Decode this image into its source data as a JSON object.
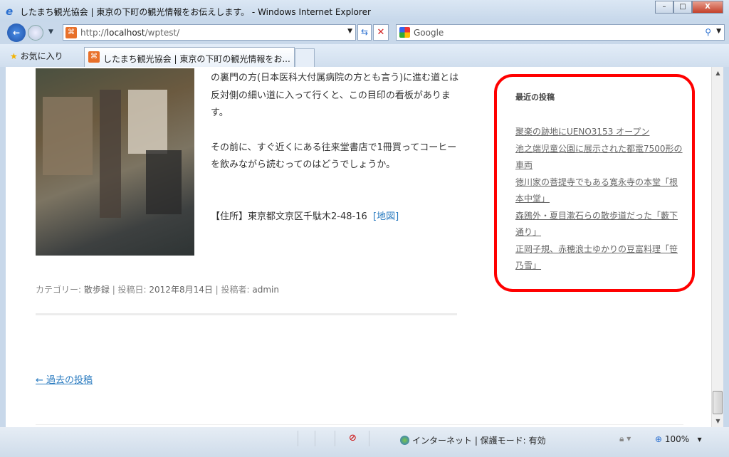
{
  "window": {
    "title": "したまち観光協会 | 東京の下町の観光情報をお伝えします。 - Windows Internet Explorer",
    "minimize": "–",
    "maximize": "□",
    "close": "X"
  },
  "toolbar": {
    "url_prefix": "http://",
    "url_host": "localhost",
    "url_path": "/wptest/",
    "search_placeholder": "Google"
  },
  "tabs": {
    "favorites_label": "お気に入り",
    "active_tab": "したまち観光協会 | 東京の下町の観光情報をお..."
  },
  "article": {
    "paragraph1": "の裏門の方(日本医科大付属病院の方とも言う)に進む道とは反対側の細い道に入って行くと、この目印の看板があります。",
    "paragraph2": "その前に、すぐ近くにある往来堂書店で1冊買ってコーヒーを飲みながら読むってのはどうでしょうか。",
    "address": "【住所】東京都文京区千駄木2-48-16",
    "map_link": "[地図]",
    "meta": {
      "category_label": "カテゴリー: ",
      "category": "散歩録",
      "date_label": " | 投稿日: ",
      "date": "2012年8月14日",
      "author_label": " | 投稿者: ",
      "author": "admin"
    },
    "prev_posts": "← 過去の投稿"
  },
  "sidebar": {
    "heading": "最近の投稿",
    "items": [
      {
        "label": "聚楽の跡地にUENO3153 オープン"
      },
      {
        "label": "池之端児童公園に展示された都電7500形の車両"
      },
      {
        "label": "徳川家の菩提寺でもある寛永寺の本堂「根本中堂」"
      },
      {
        "label": "森鴎外・夏目漱石らの散歩道だった「藪下通り」"
      },
      {
        "label": "正岡子規、赤穂浪士ゆかりの豆富料理「笹乃雪」"
      }
    ],
    "highlight_color": "#ff0000"
  },
  "statusbar": {
    "zone": "インターネット | 保護モード: 有効",
    "zoom": "100%"
  }
}
